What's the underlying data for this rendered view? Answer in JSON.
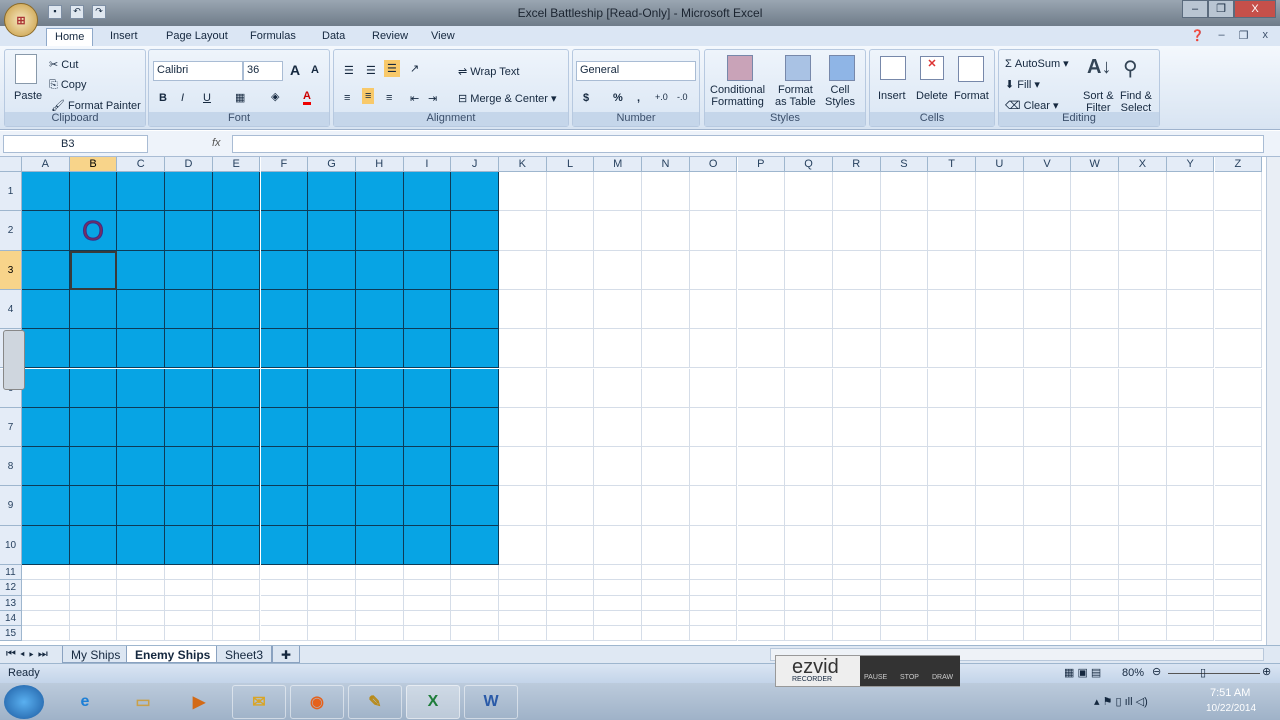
{
  "window": {
    "title": "Excel Battleship  [Read-Only] - Microsoft Excel",
    "minimize": "–",
    "restore": "❐",
    "close": "X"
  },
  "tabs": [
    "Home",
    "Insert",
    "Page Layout",
    "Formulas",
    "Data",
    "Review",
    "View"
  ],
  "active_tab": "Home",
  "ribbon": {
    "clipboard": {
      "label": "Clipboard",
      "paste": "Paste",
      "cut": "Cut",
      "copy": "Copy",
      "format_painter": "Format Painter"
    },
    "font": {
      "label": "Font",
      "name": "Calibri",
      "size": "36",
      "bold": "B",
      "italic": "I",
      "underline": "U",
      "grow": "A",
      "shrink": "A"
    },
    "alignment": {
      "label": "Alignment",
      "wrap": "Wrap Text",
      "merge": "Merge & Center"
    },
    "number": {
      "label": "Number",
      "format": "General",
      "currency": "$",
      "percent": "%",
      "comma": ",",
      "inc": "+.0",
      "dec": "-.0"
    },
    "styles": {
      "label": "Styles",
      "conditional": "Conditional",
      "conditional2": "Formatting",
      "format_table": "Format",
      "format_table2": "as Table",
      "cell_styles": "Cell",
      "cell_styles2": "Styles"
    },
    "cells": {
      "label": "Cells",
      "insert": "Insert",
      "delete": "Delete",
      "format": "Format"
    },
    "editing": {
      "label": "Editing",
      "autosum": "AutoSum",
      "fill": "Fill",
      "clear": "Clear",
      "sort": "Sort &",
      "sort2": "Filter",
      "find": "Find &",
      "find2": "Select"
    }
  },
  "formula_bar": {
    "name_box": "B3",
    "fx": "fx",
    "value": ""
  },
  "grid": {
    "columns": [
      "A",
      "B",
      "C",
      "D",
      "E",
      "F",
      "G",
      "H",
      "I",
      "J",
      "K",
      "L",
      "M",
      "N",
      "O",
      "P",
      "Q",
      "R",
      "S",
      "T",
      "U",
      "V",
      "W",
      "X",
      "Y",
      "Z"
    ],
    "rows": [
      "1",
      "2",
      "3",
      "4",
      "5",
      "6",
      "7",
      "8",
      "9",
      "10",
      "11",
      "12",
      "13",
      "14",
      "15"
    ],
    "fill_color": "#07a4e4",
    "filled_range": "A1:J10",
    "selected_cell": "B3",
    "cells": {
      "B2": "O"
    }
  },
  "sheet_tabs": [
    "My Ships",
    "Enemy Ships",
    "Sheet3"
  ],
  "active_sheet": "Enemy Ships",
  "status": {
    "ready": "Ready",
    "zoom": "80%"
  },
  "ezvid": {
    "logo": "ezvid",
    "sub": "RECORDER",
    "pause": "PAUSE",
    "stop": "STOP",
    "draw": "DRAW"
  },
  "taskbar": {
    "time": "7:51 AM",
    "date": "10/22/2014",
    "apps": [
      "internet-explorer",
      "file-explorer",
      "media-player",
      "outlook",
      "firefox",
      "ezvid",
      "excel",
      "word"
    ]
  }
}
